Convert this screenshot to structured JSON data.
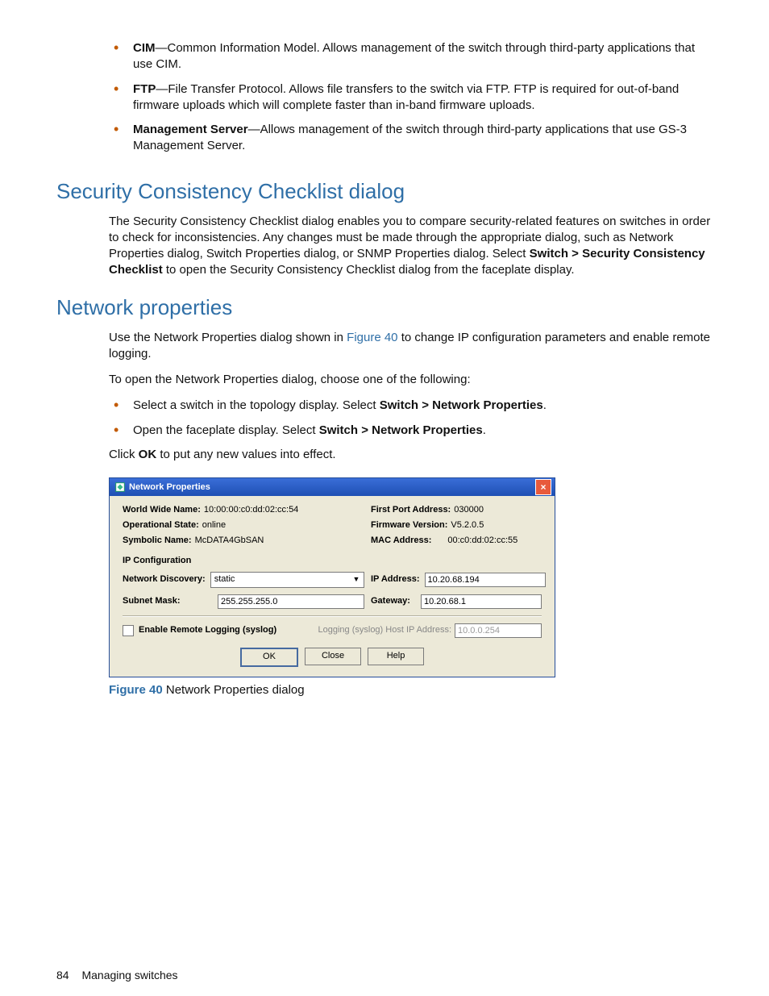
{
  "intro_bullets": [
    {
      "term": "CIM",
      "text": "—Common Information Model. Allows management of the switch through third-party applications that use CIM."
    },
    {
      "term": "FTP",
      "text": "—File Transfer Protocol. Allows file transfers to the switch via FTP. FTP is required for out-of-band firmware uploads which will complete faster than in-band firmware uploads."
    },
    {
      "term": "Management Server",
      "text": "—Allows management of the switch through third-party applications that use GS-3 Management Server."
    }
  ],
  "scc": {
    "heading": "Security Consistency Checklist dialog",
    "para_pre": "The Security Consistency Checklist dialog enables you to compare security-related features on switches in order to check for inconsistencies. Any changes must be made through the appropriate dialog, such as Network Properties dialog, Switch Properties dialog, or SNMP Properties dialog. Select ",
    "menu": "Switch > Security Consistency Checklist",
    "para_post": " to open the Security Consistency Checklist dialog from the faceplate display."
  },
  "net": {
    "heading": "Network properties",
    "p1_pre": "Use the Network Properties dialog shown in ",
    "p1_link": "Figure 40",
    "p1_post": " to change IP configuration parameters and enable remote logging.",
    "p2": "To open the Network Properties dialog, choose one of the following:",
    "bullets": [
      {
        "pre": "Select a switch in the topology display. Select ",
        "bold": "Switch > Network Properties",
        "post": "."
      },
      {
        "pre": "Open the faceplate display. Select ",
        "bold": "Switch > Network Properties",
        "post": "."
      }
    ],
    "p3_pre": "Click ",
    "p3_bold": "OK",
    "p3_post": " to put any new values into effect."
  },
  "dlg": {
    "title": "Network Properties",
    "labels": {
      "wwn": "World Wide Name:",
      "first_port": "First Port Address:",
      "op_state": "Operational State:",
      "fw": "Firmware Version:",
      "sym": "Symbolic Name:",
      "mac": "MAC Address:",
      "ipcfg": "IP Configuration",
      "net_disc": "Network Discovery:",
      "ip_addr": "IP Address:",
      "subnet": "Subnet Mask:",
      "gateway": "Gateway:",
      "enable_log": "Enable Remote Logging (syslog)",
      "log_host": "Logging (syslog) Host IP Address:"
    },
    "values": {
      "wwn": "10:00:00:c0:dd:02:cc:54",
      "first_port": "030000",
      "op_state": "online",
      "fw": "V5.2.0.5",
      "sym": "McDATA4GbSAN",
      "mac": "00:c0:dd:02:cc:55",
      "net_disc": "static",
      "ip_addr": "10.20.68.194",
      "subnet": "255.255.255.0",
      "gateway": "10.20.68.1",
      "log_host": "10.0.0.254"
    },
    "buttons": {
      "ok": "OK",
      "close": "Close",
      "help": "Help"
    }
  },
  "caption": {
    "label": "Figure 40",
    "text": "  Network Properties dialog"
  },
  "footer": {
    "page_num": "84",
    "section": "Managing switches"
  }
}
